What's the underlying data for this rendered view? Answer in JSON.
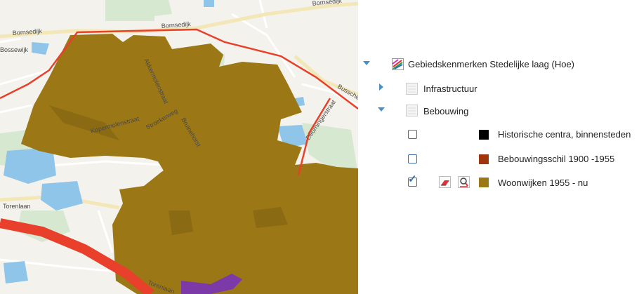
{
  "map": {
    "street_labels": [
      "Bornsedijk",
      "Bornsedijk",
      "Bornsedijk",
      "Bossewijk",
      "Torenlaan",
      "Torenlaan",
      "Busscherweg",
      "Deurningerstraat",
      "Kopermolenstraat",
      "Stroekerweg",
      "Bruinehorst",
      "Akkermolenstraat"
    ]
  },
  "legend": {
    "group_title": "Gebiedskenmerken Stedelijke laag (Hoe)",
    "sublayers": [
      {
        "label": "Infrastructuur",
        "expanded": false
      },
      {
        "label": "Bebouwing",
        "expanded": true
      }
    ],
    "classes": [
      {
        "label": "Historische centra, binnensteden",
        "checked": false,
        "color": "#000000"
      },
      {
        "label": "Bebouwingsschil 1900 -1955",
        "checked": false,
        "color": "#a0360e"
      },
      {
        "label": "Woonwijken 1955 - nu",
        "checked": true,
        "color": "#9b7716"
      }
    ]
  },
  "colors": {
    "area_fill": "#9b7716",
    "water": "#8fc5e8",
    "main_road": "#e8402a",
    "purple_area": "#7b3aa7"
  }
}
